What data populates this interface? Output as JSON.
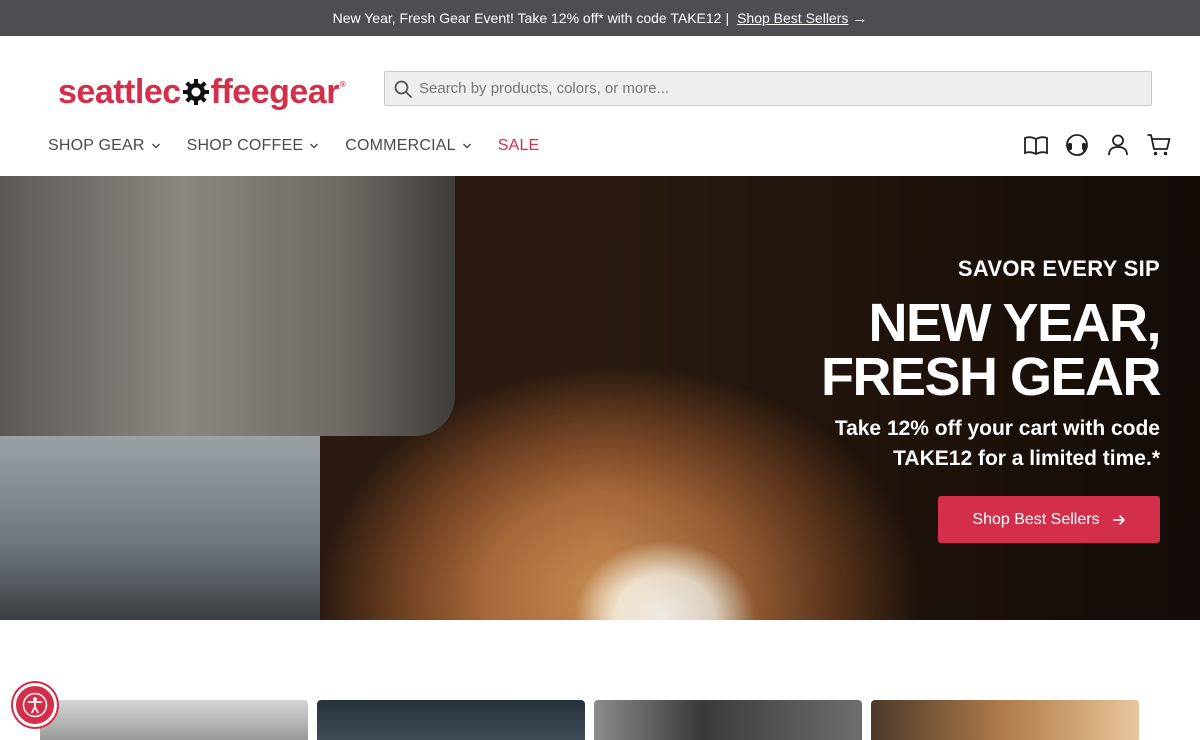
{
  "promo": {
    "text": "New Year, Fresh Gear Event! Take 12% off* with code TAKE12",
    "separator": "|",
    "link_label": "Shop Best Sellers",
    "arrow": "→"
  },
  "header": {
    "logo": {
      "part1": "seattlec",
      "part2": "ffeegear",
      "reg": "®",
      "gear_icon": "gear-icon"
    },
    "search": {
      "placeholder": "Search by products, colors, or more..."
    },
    "nav": [
      {
        "label": "SHOP GEAR",
        "has_dropdown": true
      },
      {
        "label": "SHOP COFFEE",
        "has_dropdown": true
      },
      {
        "label": "COMMERCIAL",
        "has_dropdown": true
      },
      {
        "label": "SALE",
        "has_dropdown": false
      }
    ],
    "utility_icons": [
      "book-icon",
      "headset-icon",
      "user-icon",
      "cart-icon"
    ]
  },
  "hero": {
    "eyebrow": "SAVOR EVERY SIP",
    "title_line1": "NEW YEAR,",
    "title_line2": "FRESH GEAR",
    "sub_line1": "Take 12% off your cart with code",
    "sub_line2": "TAKE12 for a limited time.*",
    "cta_label": "Shop Best Sellers"
  },
  "colors": {
    "brand": "#d42f4a",
    "promo_bg": "#4d4f54"
  }
}
